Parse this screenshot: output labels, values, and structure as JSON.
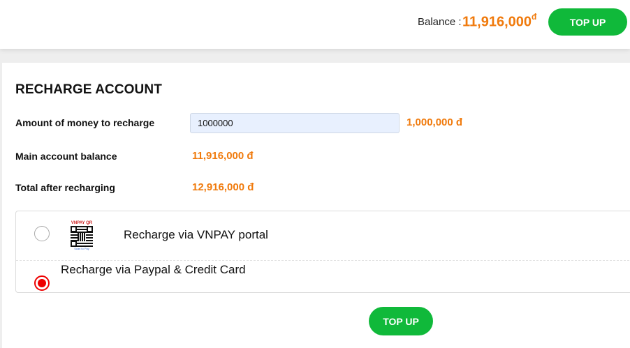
{
  "header": {
    "balance_label": "Balance :",
    "balance_amount": "11,916,000",
    "currency_symbol": "đ",
    "top_up_label": "TOP UP"
  },
  "recharge": {
    "title": "RECHARGE ACCOUNT",
    "amount_label": "Amount of money to recharge",
    "amount_input_value": "1000000",
    "amount_formatted": "1,000,000 đ",
    "main_balance_label": "Main account balance",
    "main_balance_value": "11,916,000 đ",
    "total_label": "Total after recharging",
    "total_value": "12,916,000 đ"
  },
  "payment_methods": [
    {
      "label": "Recharge via VNPAY portal",
      "selected": false,
      "icon": "vnpay-qr-icon",
      "icon_caption_top": "VNPAY QR",
      "icon_caption_bottom": "Scan to Pay"
    },
    {
      "label": "Recharge via Paypal & Credit Card",
      "selected": true
    }
  ],
  "footer": {
    "top_up_label": "TOP UP"
  },
  "colors": {
    "accent_green": "#10b93a",
    "amount_orange": "#f07a0c",
    "radio_selected": "#e00000"
  }
}
